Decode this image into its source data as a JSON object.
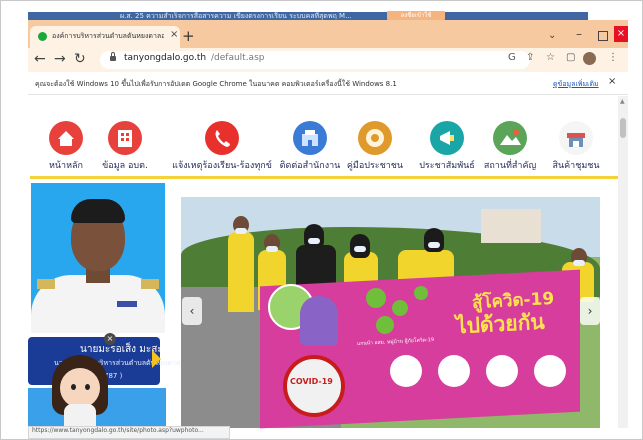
{
  "word": {
    "titlebar_text": "ผ.ส. 25 ความสำเร็จการสื่อสารความ เขียงตรงการเรียน ระบบคลที่สุดพฤ M...",
    "share_label": "ลงชื่อเข้าใช้"
  },
  "browser": {
    "tab_title": "องค์การบริหารส่วนตำบลตันหยงดาลอ - ...",
    "new_tab_icon": "plus-icon",
    "url_host": "tanyongdalo.go.th",
    "url_path": "/default.asp",
    "info_text": "คุณจะต้องใช้ Windows 10 ขึ้นไปเพื่อรับการอัปเดต Google Chrome ในอนาคต คอมพิวเตอร์เครื่องนี้ใช้ Windows 8.1",
    "info_link": "ดูข้อมูลเพิ่มเติม",
    "status_url": "https://www.tanyongdalo.go.th/site/photo.asp?uwphoto..."
  },
  "site": {
    "nav": [
      {
        "label": "หน้าหลัก",
        "icon": "home-icon",
        "color": "#e8413c"
      },
      {
        "label": "ข้อมูล อบต.",
        "icon": "building-icon",
        "color": "#e8413c"
      },
      {
        "label": "แจ้งเหตุร้องเรียน-ร้องทุกข์",
        "icon": "phone-icon",
        "color": "#e8312c"
      },
      {
        "label": "ติดต่อสำนักงาน",
        "icon": "office-icon",
        "color": "#3a7bd5"
      },
      {
        "label": "คู่มือประชาชน",
        "icon": "handbook-icon",
        "color": "#e09a2b"
      },
      {
        "label": "ประชาสัมพันธ์",
        "icon": "megaphone-icon",
        "color": "#1aa6a6"
      },
      {
        "label": "สถานที่สำคัญ",
        "icon": "landmark-icon",
        "color": "#5aa55a"
      },
      {
        "label": "สินค้าชุมชน",
        "icon": "shop-icon",
        "color": "#d9534f"
      }
    ],
    "official": {
      "name": "นายมะรอเส็ง มะสะ",
      "position": "นายกองค์การบริหารส่วนตำบลตันหยงดาลอ",
      "code": "787 )"
    },
    "banner": {
      "title_line1": "สู้โควิด-19",
      "title_line2": "ไปด้วยกัน",
      "badge": "COVID-19",
      "small_text": "แกนนำ อสม. หมู่บ้าน สู้ภัยโควิด-19"
    }
  },
  "colors": {
    "tabstrip": "#f6c9a0",
    "accent_yellow": "#f4d23b",
    "portrait_bg": "#29a7ee",
    "name_banner": "#1b3c96",
    "banner_bg": "#d63d9c"
  }
}
